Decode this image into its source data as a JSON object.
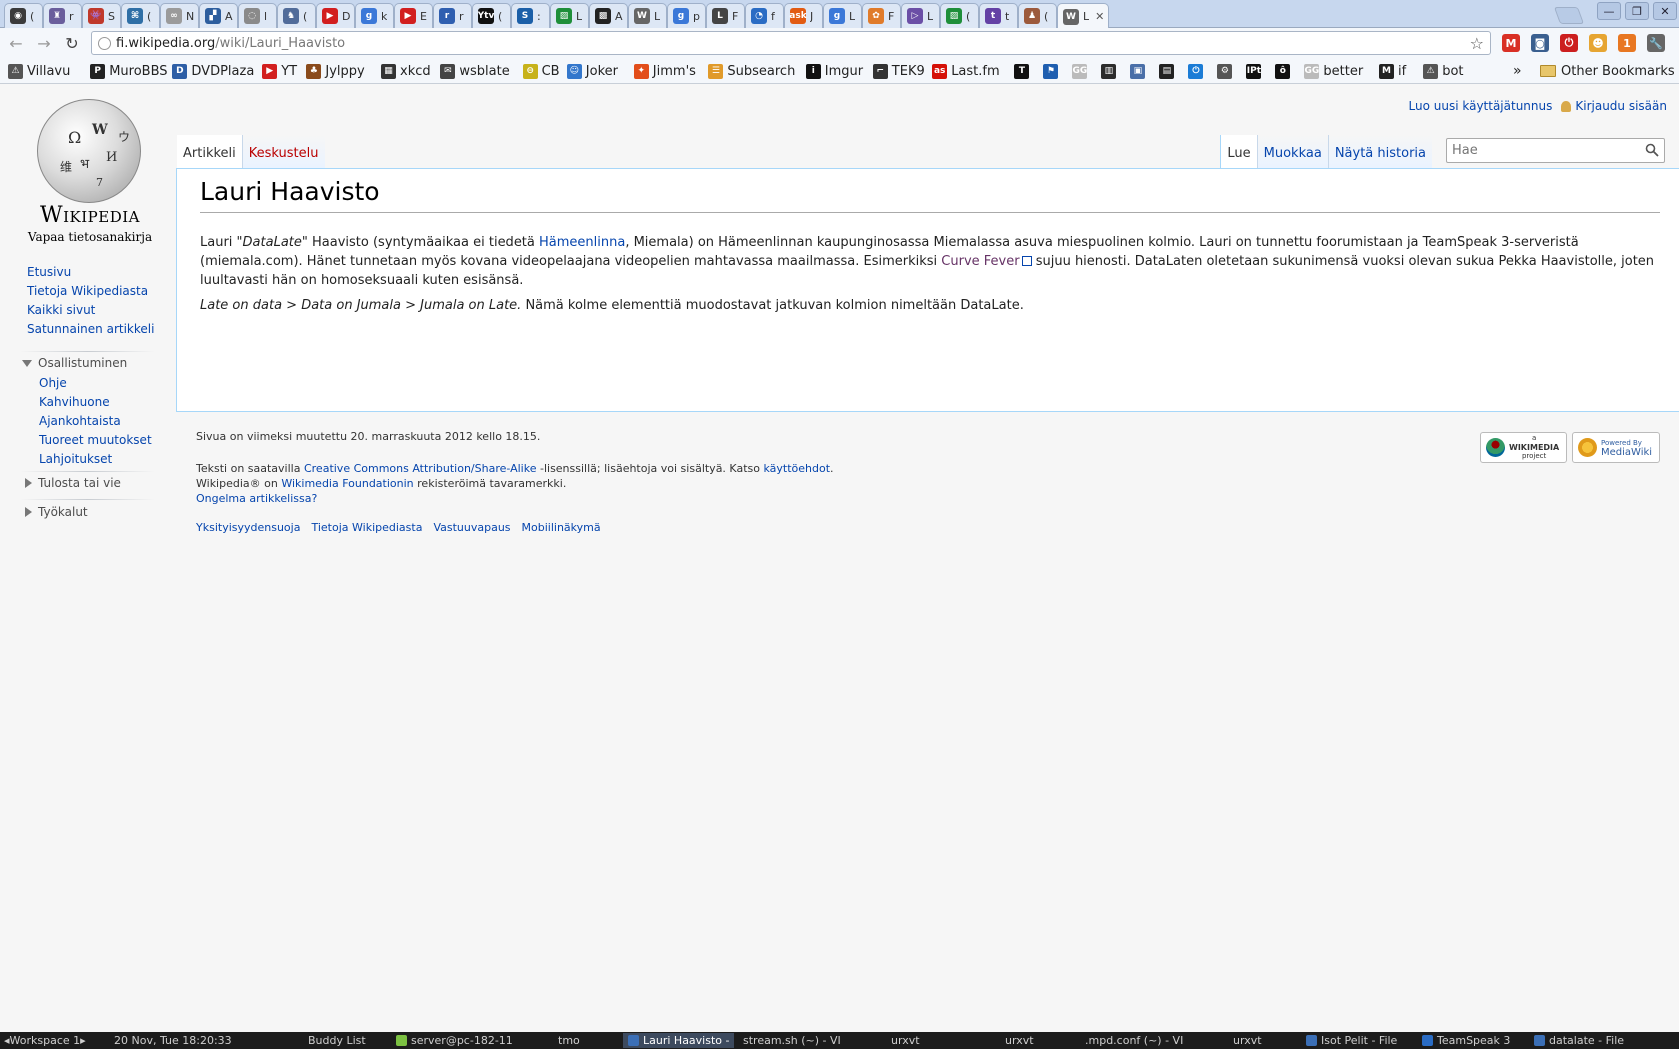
{
  "browser": {
    "tabs": [
      {
        "title": "(",
        "color": "#3b3b3b",
        "glyph": "◉"
      },
      {
        "title": "r",
        "color": "#6a5e9c",
        "glyph": "♜"
      },
      {
        "title": "S",
        "color": "#c0392b",
        "glyph": "👾"
      },
      {
        "title": "(",
        "color": "#2f6fa6",
        "glyph": "⌘"
      },
      {
        "title": "N",
        "color": "#9b9b9b",
        "glyph": "∞"
      },
      {
        "title": "A",
        "color": "#2d5e9e",
        "glyph": "▞"
      },
      {
        "title": "l",
        "color": "#8a8a8a",
        "glyph": "◌"
      },
      {
        "title": "(",
        "color": "#516c9a",
        "glyph": "♞"
      },
      {
        "title": "D",
        "color": "#d21f1f",
        "glyph": "▶"
      },
      {
        "title": "k",
        "color": "#3b78d8",
        "glyph": "g"
      },
      {
        "title": "E",
        "color": "#d21f1f",
        "glyph": "▶"
      },
      {
        "title": "r",
        "color": "#2f5fb0",
        "glyph": "r"
      },
      {
        "title": "(",
        "color": "#111111",
        "glyph": "Ytv"
      },
      {
        "title": ":",
        "color": "#1b5fa8",
        "glyph": "S"
      },
      {
        "title": "L",
        "color": "#1f8f3a",
        "glyph": "▨"
      },
      {
        "title": "A",
        "color": "#222222",
        "glyph": "▩"
      },
      {
        "title": "L",
        "color": "#666666",
        "glyph": "W"
      },
      {
        "title": "p",
        "color": "#3b78d8",
        "glyph": "g"
      },
      {
        "title": "F",
        "color": "#444444",
        "glyph": "L"
      },
      {
        "title": "f",
        "color": "#2a6cc4",
        "glyph": "◔"
      },
      {
        "title": "J",
        "color": "#e25b12",
        "glyph": "ask"
      },
      {
        "title": "L",
        "color": "#3b78d8",
        "glyph": "g"
      },
      {
        "title": "F",
        "color": "#e07b2a",
        "glyph": "✿"
      },
      {
        "title": "L",
        "color": "#6b4fa6",
        "glyph": "▷"
      },
      {
        "title": "(",
        "color": "#1f8f3a",
        "glyph": "▨"
      },
      {
        "title": "t",
        "color": "#6441a5",
        "glyph": "t"
      },
      {
        "title": "(",
        "color": "#9c5a3c",
        "glyph": "♟"
      },
      {
        "title": "L",
        "color": "#666666",
        "glyph": "W",
        "close": "✕"
      }
    ],
    "window_controls": [
      "—",
      "❐",
      "✕"
    ],
    "url_host": "fi.wikipedia.org",
    "url_path": "/wiki/Lauri_Haavisto",
    "star_icon": "☆",
    "extensions": [
      {
        "glyph": "M",
        "color": "#d93025"
      },
      {
        "glyph": "◙",
        "color": "#3a5f8f"
      },
      {
        "glyph": "⏻",
        "color": "#cc1f1f"
      },
      {
        "glyph": "☻",
        "color": "#e6a532"
      },
      {
        "glyph": "1",
        "color": "#e87722"
      },
      {
        "glyph": "🔧",
        "color": "#666666"
      }
    ],
    "bookmarks": [
      {
        "label": "Villavu",
        "color": "#555555",
        "glyph": "⚠"
      },
      {
        "label": "MuroBBS",
        "color": "#222222",
        "glyph": "P"
      },
      {
        "label": "DVDPlaza",
        "color": "#2d5ea6",
        "glyph": "D"
      },
      {
        "label": "YT",
        "color": "#d21f1f",
        "glyph": "▶"
      },
      {
        "label": "Jylppy",
        "color": "#8a4b1c",
        "glyph": "♣"
      },
      {
        "label": "xkcd",
        "color": "#333333",
        "glyph": "▦"
      },
      {
        "label": "wsblate",
        "color": "#444444",
        "glyph": "✉"
      },
      {
        "label": "CB",
        "color": "#c7b21a",
        "glyph": "⊖"
      },
      {
        "label": "Joker",
        "color": "#3377cc",
        "glyph": "☺"
      },
      {
        "label": "Jimm's",
        "color": "#e24d1a",
        "glyph": "✦"
      },
      {
        "label": "Subsearch",
        "color": "#e09a2a",
        "glyph": "☰"
      },
      {
        "label": "Imgur",
        "color": "#111111",
        "glyph": "i"
      },
      {
        "label": "TEK9",
        "color": "#333333",
        "glyph": "⌐"
      },
      {
        "label": "Last.fm",
        "color": "#d51007",
        "glyph": "as"
      }
    ],
    "bookmark_icons": [
      {
        "color": "#111111",
        "glyph": "T"
      },
      {
        "color": "#1f5fb0",
        "glyph": "⚑"
      },
      {
        "color": "#bbbbbb",
        "glyph": "GG"
      },
      {
        "color": "#2c2c2c",
        "glyph": "▥"
      },
      {
        "color": "#4a6fa8",
        "glyph": "▣"
      },
      {
        "color": "#222222",
        "glyph": "▤"
      },
      {
        "color": "#1b7cd6",
        "glyph": "⏻"
      },
      {
        "color": "#555555",
        "glyph": "⚙"
      },
      {
        "color": "#111111",
        "glyph": "IPt"
      },
      {
        "color": "#111111",
        "glyph": "ô"
      }
    ],
    "bookmarks_tail": [
      {
        "label": "better",
        "color": "#bbbbbb",
        "glyph": "GG"
      },
      {
        "label": "if",
        "color": "#222222",
        "glyph": "M"
      },
      {
        "label": "bot",
        "color": "#555555",
        "glyph": "⚠"
      }
    ],
    "overflow_icon": "»",
    "other_bookmarks": "Other Bookmarks"
  },
  "wiki": {
    "wordmark": "Wikipedia",
    "tagline": "Vapaa tietosanakirja",
    "personal": {
      "create_account": "Luo uusi käyttäjätunnus",
      "login": "Kirjaudu sisään"
    },
    "namespace_tabs": {
      "article": "Artikkeli",
      "talk": "Keskustelu"
    },
    "view_tabs": {
      "read": "Lue",
      "edit": "Muokkaa",
      "history": "Näytä historia"
    },
    "search_placeholder": "Hae",
    "title": "Lauri Haavisto",
    "p1": {
      "a": "Lauri \"",
      "b": "DataLate",
      "c": "\" Haavisto (syntymäaikaa ei tiedetä ",
      "link1": "Hämeenlinna",
      "d": ", Miemala) on Hämeenlinnan kaupunginosassa Miemalassa asuva miespuolinen kolmio. Lauri on tunnettu foorumistaan ja TeamSpeak 3-serveristä (miemala.com). Hänet tunnetaan myös kovana videopelaajana videopelien mahtavassa maailmassa. Esimerkiksi ",
      "link2": "Curve Fever",
      "e": " sujuu hienosti. DataLaten oletetaan sukunimensä vuoksi olevan sukua Pekka Haavistolle, joten luultavasti hän on homoseksuaali kuten esisänsä."
    },
    "p2": {
      "italic": "Late on data > Data on Jumala > Jumala on Late.",
      "rest": " Nämä kolme elementtiä muodostavat jatkuvan kolmion nimeltään DataLate."
    },
    "nav": [
      "Etusivu",
      "Tietoja Wikipediasta",
      "Kaikki sivut",
      "Satunnainen artikkeli"
    ],
    "participate": {
      "heading": "Osallistuminen",
      "items": [
        "Ohje",
        "Kahvihuone",
        "Ajankohtaista",
        "Tuoreet muutokset",
        "Lahjoitukset"
      ]
    },
    "print_heading": "Tulosta tai vie",
    "tools_heading": "Työkalut",
    "footer": {
      "last_modified": "Sivua on viimeksi muutettu 20. marraskuuta 2012 kello 18.15.",
      "license_a": "Teksti on saatavilla ",
      "license_link": "Creative Commons Attribution/Share-Alike",
      "license_b": " -lisenssillä; lisäehtoja voi sisältyä. Katso ",
      "terms_link": "käyttöehdot",
      "license_c": ".",
      "tm_a": "Wikipedia® on ",
      "tm_link": "Wikimedia Foundationin",
      "tm_b": " rekisteröimä tavaramerkki.",
      "problem": "Ongelma artikkelissa?",
      "links": [
        "Yksityisyydensuoja",
        "Tietoja Wikipediasta",
        "Vastuuvapaus",
        "Mobiilinäkymä"
      ],
      "badge_wikimedia": "WIKIMEDIA",
      "badge_wikimedia_top": "a",
      "badge_wikimedia_bottom": "project",
      "badge_mediawiki_top": "Powered By",
      "badge_mediawiki": "MediaWiki"
    }
  },
  "taskbar": {
    "workspace": "Workspace 1",
    "clock": "20 Nov, Tue 18:20:33",
    "items": [
      {
        "label": "Buddy List"
      },
      {
        "label": "server@pc-182-11"
      },
      {
        "label": "tmo"
      },
      {
        "label": "Lauri Haavisto -",
        "active": true
      },
      {
        "label": "stream.sh (~) - VI"
      },
      {
        "label": "urxvt"
      },
      {
        "label": "urxvt"
      },
      {
        "label": ".mpd.conf (~) - VI"
      },
      {
        "label": "urxvt"
      },
      {
        "label": "Isot Pelit - File"
      },
      {
        "label": "TeamSpeak 3"
      },
      {
        "label": "datalate - File"
      }
    ]
  }
}
